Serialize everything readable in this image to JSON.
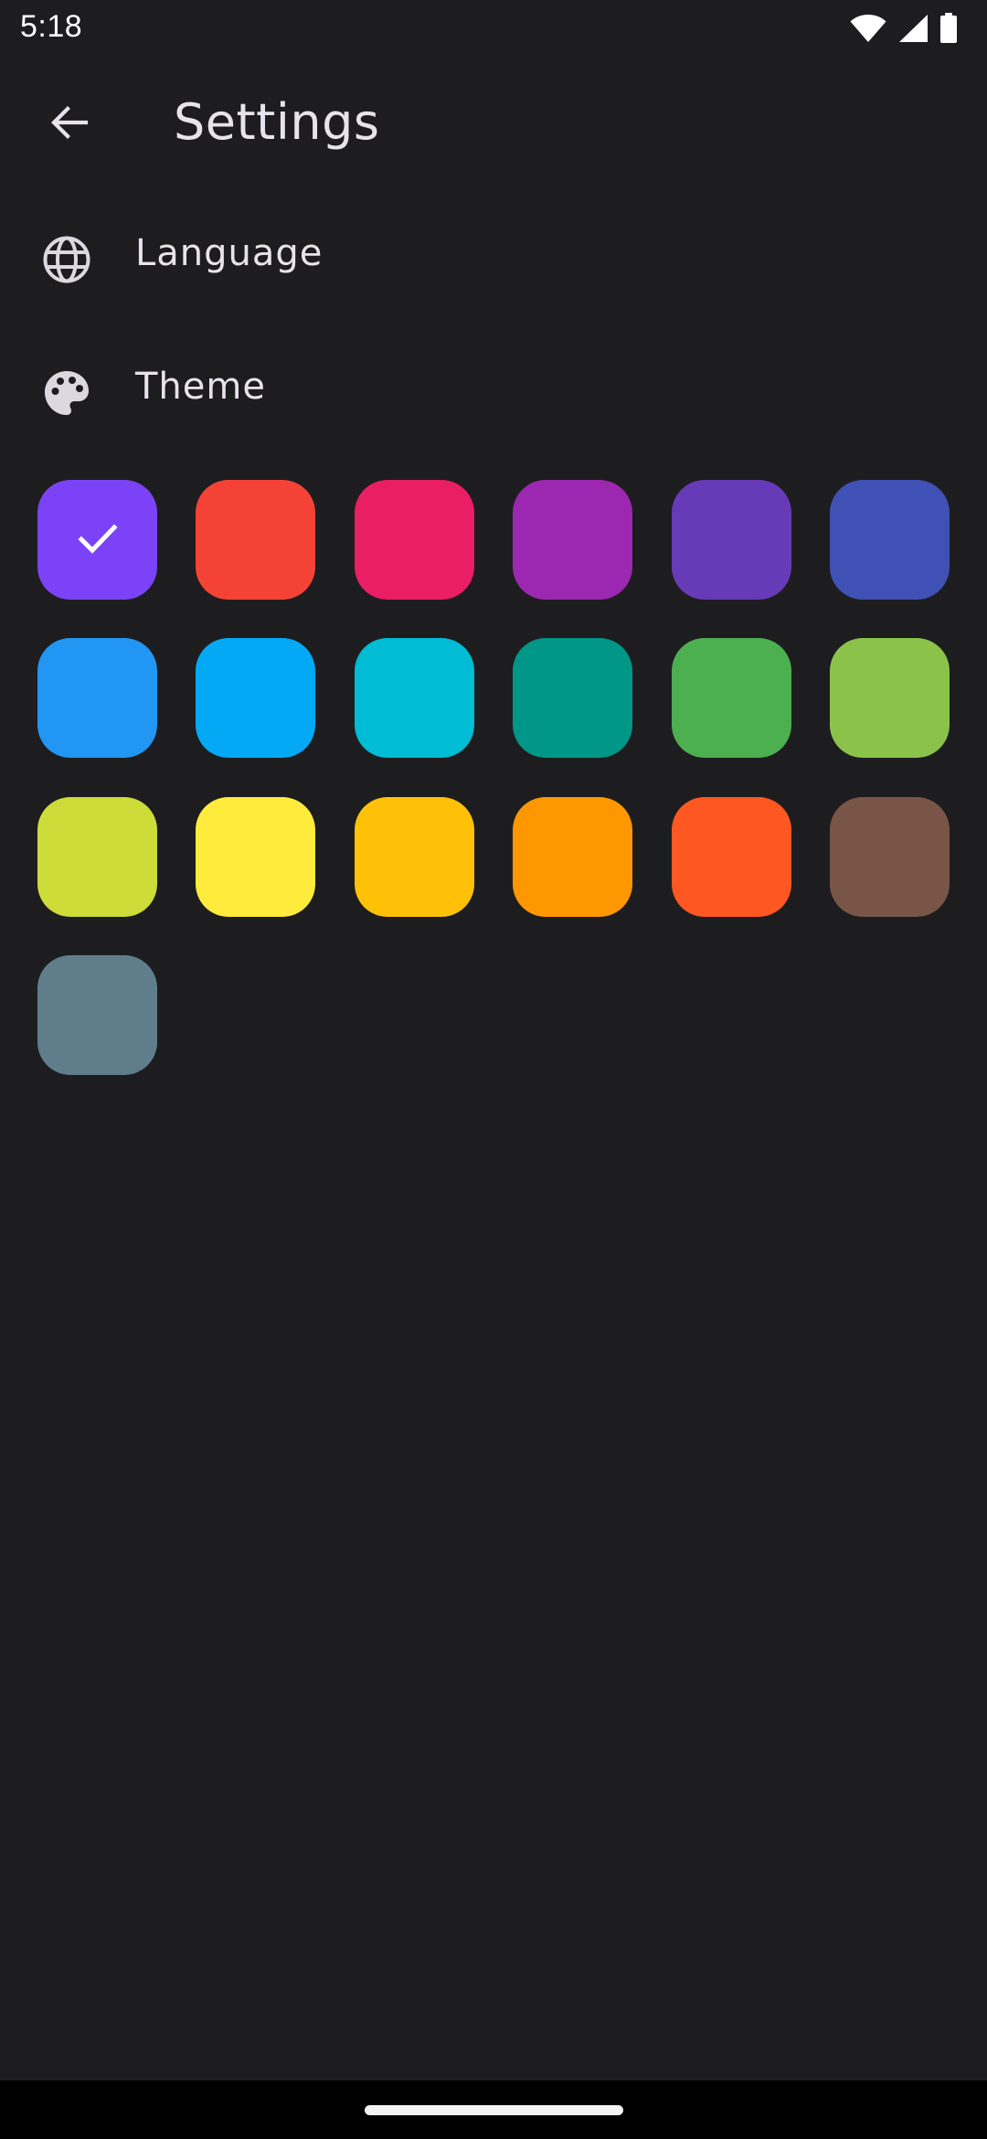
{
  "status_bar": {
    "time": "5:18",
    "icons": [
      "wifi-icon",
      "cellular-signal-icon",
      "battery-icon"
    ]
  },
  "top_bar": {
    "title": "Settings",
    "back_icon": "arrow-left-icon"
  },
  "settings": {
    "language": {
      "label": "Language",
      "icon": "globe-icon"
    },
    "theme": {
      "label": "Theme",
      "icon": "palette-icon"
    }
  },
  "theme_colors": {
    "selected_index": 0,
    "swatches": [
      {
        "name": "deep-violet",
        "color": "#7c42f7"
      },
      {
        "name": "red",
        "color": "#f44336"
      },
      {
        "name": "pink",
        "color": "#e91e63"
      },
      {
        "name": "purple",
        "color": "#9c27b0"
      },
      {
        "name": "deep-purple",
        "color": "#673ab7"
      },
      {
        "name": "indigo",
        "color": "#3f51b5"
      },
      {
        "name": "blue",
        "color": "#2196f3"
      },
      {
        "name": "light-blue",
        "color": "#03a9f4"
      },
      {
        "name": "cyan",
        "color": "#00bcd4"
      },
      {
        "name": "teal",
        "color": "#009688"
      },
      {
        "name": "green",
        "color": "#4caf50"
      },
      {
        "name": "light-green",
        "color": "#8bc34a"
      },
      {
        "name": "lime",
        "color": "#cddc39"
      },
      {
        "name": "yellow",
        "color": "#ffeb3b"
      },
      {
        "name": "amber",
        "color": "#ffc107"
      },
      {
        "name": "orange",
        "color": "#ff9800"
      },
      {
        "name": "deep-orange",
        "color": "#ff5722"
      },
      {
        "name": "brown",
        "color": "#795548"
      },
      {
        "name": "blue-grey",
        "color": "#607d8b"
      }
    ]
  },
  "colors": {
    "background": "#1d1d1f",
    "on_surface": "#e8e3ea",
    "icon": "#dcd8e0"
  }
}
